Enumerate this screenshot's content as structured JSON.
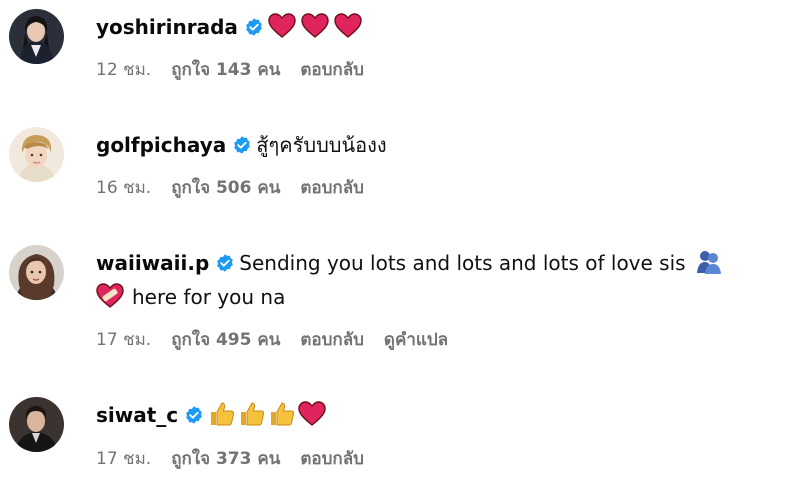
{
  "comments": [
    {
      "username": "yoshirinrada",
      "verified": true,
      "text": "",
      "emojis": [
        "red-heart",
        "red-heart",
        "red-heart"
      ],
      "time": "12 ชม.",
      "likes": "ถูกใจ 143 คน",
      "reply": "ตอบกลับ"
    },
    {
      "username": "golfpichaya",
      "verified": true,
      "text": "สู้ๆครับบบน้องง",
      "time": "16 ชม.",
      "likes": "ถูกใจ 506 คน",
      "reply": "ตอบกลับ"
    },
    {
      "username": "waiiwaii.p",
      "verified": true,
      "text": "Sending you lots and lots and lots of love sis",
      "emoji_after_text": "hugging-people",
      "line2_emoji": "mending-heart",
      "text_line2": "here for you na",
      "time": "17 ชม.",
      "likes": "ถูกใจ 495 คน",
      "reply": "ตอบกลับ",
      "translate": "ดูคำแปล"
    },
    {
      "username": "siwat_c",
      "verified": true,
      "emojis": [
        "thumbs-up",
        "thumbs-up",
        "thumbs-up",
        "red-heart"
      ],
      "time": "17 ชม.",
      "likes": "ถูกใจ 373 คน",
      "reply": "ตอบกลับ"
    }
  ],
  "colors": {
    "verified": "#1d9bf0",
    "meta_text": "#737373",
    "heart": "#e0245e",
    "thumb": "#f6c23e"
  }
}
